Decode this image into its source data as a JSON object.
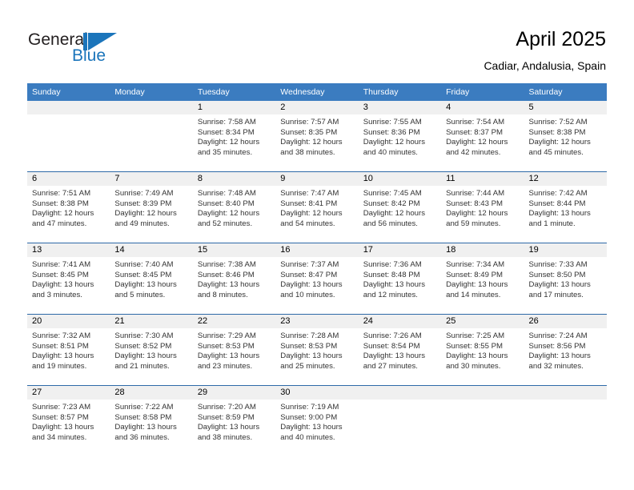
{
  "brand": {
    "name_part1": "General",
    "name_part2": "Blue",
    "logo_icon": "triangle-flag-icon",
    "accent_color": "#1b75bb"
  },
  "header": {
    "title": "April 2025",
    "subtitle": "Cadiar, Andalusia, Spain"
  },
  "theme": {
    "header_blue": "#3b7cc0",
    "row_divider_blue": "#2e6aa8",
    "daynum_band_gray": "#f0f0f0",
    "text_color": "#333333"
  },
  "calendar": {
    "weekday_headers": [
      "Sunday",
      "Monday",
      "Tuesday",
      "Wednesday",
      "Thursday",
      "Friday",
      "Saturday"
    ],
    "labels": {
      "sunrise": "Sunrise:",
      "sunset": "Sunset:",
      "daylight": "Daylight:"
    },
    "weeks": [
      [
        {
          "day": "",
          "empty": true
        },
        {
          "day": "",
          "empty": true
        },
        {
          "day": "1",
          "sunrise": "Sunrise: 7:58 AM",
          "sunset": "Sunset: 8:34 PM",
          "daylight_line1": "Daylight: 12 hours",
          "daylight_line2": "and 35 minutes."
        },
        {
          "day": "2",
          "sunrise": "Sunrise: 7:57 AM",
          "sunset": "Sunset: 8:35 PM",
          "daylight_line1": "Daylight: 12 hours",
          "daylight_line2": "and 38 minutes."
        },
        {
          "day": "3",
          "sunrise": "Sunrise: 7:55 AM",
          "sunset": "Sunset: 8:36 PM",
          "daylight_line1": "Daylight: 12 hours",
          "daylight_line2": "and 40 minutes."
        },
        {
          "day": "4",
          "sunrise": "Sunrise: 7:54 AM",
          "sunset": "Sunset: 8:37 PM",
          "daylight_line1": "Daylight: 12 hours",
          "daylight_line2": "and 42 minutes."
        },
        {
          "day": "5",
          "sunrise": "Sunrise: 7:52 AM",
          "sunset": "Sunset: 8:38 PM",
          "daylight_line1": "Daylight: 12 hours",
          "daylight_line2": "and 45 minutes."
        }
      ],
      [
        {
          "day": "6",
          "sunrise": "Sunrise: 7:51 AM",
          "sunset": "Sunset: 8:38 PM",
          "daylight_line1": "Daylight: 12 hours",
          "daylight_line2": "and 47 minutes."
        },
        {
          "day": "7",
          "sunrise": "Sunrise: 7:49 AM",
          "sunset": "Sunset: 8:39 PM",
          "daylight_line1": "Daylight: 12 hours",
          "daylight_line2": "and 49 minutes."
        },
        {
          "day": "8",
          "sunrise": "Sunrise: 7:48 AM",
          "sunset": "Sunset: 8:40 PM",
          "daylight_line1": "Daylight: 12 hours",
          "daylight_line2": "and 52 minutes."
        },
        {
          "day": "9",
          "sunrise": "Sunrise: 7:47 AM",
          "sunset": "Sunset: 8:41 PM",
          "daylight_line1": "Daylight: 12 hours",
          "daylight_line2": "and 54 minutes."
        },
        {
          "day": "10",
          "sunrise": "Sunrise: 7:45 AM",
          "sunset": "Sunset: 8:42 PM",
          "daylight_line1": "Daylight: 12 hours",
          "daylight_line2": "and 56 minutes."
        },
        {
          "day": "11",
          "sunrise": "Sunrise: 7:44 AM",
          "sunset": "Sunset: 8:43 PM",
          "daylight_line1": "Daylight: 12 hours",
          "daylight_line2": "and 59 minutes."
        },
        {
          "day": "12",
          "sunrise": "Sunrise: 7:42 AM",
          "sunset": "Sunset: 8:44 PM",
          "daylight_line1": "Daylight: 13 hours",
          "daylight_line2": "and 1 minute."
        }
      ],
      [
        {
          "day": "13",
          "sunrise": "Sunrise: 7:41 AM",
          "sunset": "Sunset: 8:45 PM",
          "daylight_line1": "Daylight: 13 hours",
          "daylight_line2": "and 3 minutes."
        },
        {
          "day": "14",
          "sunrise": "Sunrise: 7:40 AM",
          "sunset": "Sunset: 8:45 PM",
          "daylight_line1": "Daylight: 13 hours",
          "daylight_line2": "and 5 minutes."
        },
        {
          "day": "15",
          "sunrise": "Sunrise: 7:38 AM",
          "sunset": "Sunset: 8:46 PM",
          "daylight_line1": "Daylight: 13 hours",
          "daylight_line2": "and 8 minutes."
        },
        {
          "day": "16",
          "sunrise": "Sunrise: 7:37 AM",
          "sunset": "Sunset: 8:47 PM",
          "daylight_line1": "Daylight: 13 hours",
          "daylight_line2": "and 10 minutes."
        },
        {
          "day": "17",
          "sunrise": "Sunrise: 7:36 AM",
          "sunset": "Sunset: 8:48 PM",
          "daylight_line1": "Daylight: 13 hours",
          "daylight_line2": "and 12 minutes."
        },
        {
          "day": "18",
          "sunrise": "Sunrise: 7:34 AM",
          "sunset": "Sunset: 8:49 PM",
          "daylight_line1": "Daylight: 13 hours",
          "daylight_line2": "and 14 minutes."
        },
        {
          "day": "19",
          "sunrise": "Sunrise: 7:33 AM",
          "sunset": "Sunset: 8:50 PM",
          "daylight_line1": "Daylight: 13 hours",
          "daylight_line2": "and 17 minutes."
        }
      ],
      [
        {
          "day": "20",
          "sunrise": "Sunrise: 7:32 AM",
          "sunset": "Sunset: 8:51 PM",
          "daylight_line1": "Daylight: 13 hours",
          "daylight_line2": "and 19 minutes."
        },
        {
          "day": "21",
          "sunrise": "Sunrise: 7:30 AM",
          "sunset": "Sunset: 8:52 PM",
          "daylight_line1": "Daylight: 13 hours",
          "daylight_line2": "and 21 minutes."
        },
        {
          "day": "22",
          "sunrise": "Sunrise: 7:29 AM",
          "sunset": "Sunset: 8:53 PM",
          "daylight_line1": "Daylight: 13 hours",
          "daylight_line2": "and 23 minutes."
        },
        {
          "day": "23",
          "sunrise": "Sunrise: 7:28 AM",
          "sunset": "Sunset: 8:53 PM",
          "daylight_line1": "Daylight: 13 hours",
          "daylight_line2": "and 25 minutes."
        },
        {
          "day": "24",
          "sunrise": "Sunrise: 7:26 AM",
          "sunset": "Sunset: 8:54 PM",
          "daylight_line1": "Daylight: 13 hours",
          "daylight_line2": "and 27 minutes."
        },
        {
          "day": "25",
          "sunrise": "Sunrise: 7:25 AM",
          "sunset": "Sunset: 8:55 PM",
          "daylight_line1": "Daylight: 13 hours",
          "daylight_line2": "and 30 minutes."
        },
        {
          "day": "26",
          "sunrise": "Sunrise: 7:24 AM",
          "sunset": "Sunset: 8:56 PM",
          "daylight_line1": "Daylight: 13 hours",
          "daylight_line2": "and 32 minutes."
        }
      ],
      [
        {
          "day": "27",
          "sunrise": "Sunrise: 7:23 AM",
          "sunset": "Sunset: 8:57 PM",
          "daylight_line1": "Daylight: 13 hours",
          "daylight_line2": "and 34 minutes."
        },
        {
          "day": "28",
          "sunrise": "Sunrise: 7:22 AM",
          "sunset": "Sunset: 8:58 PM",
          "daylight_line1": "Daylight: 13 hours",
          "daylight_line2": "and 36 minutes."
        },
        {
          "day": "29",
          "sunrise": "Sunrise: 7:20 AM",
          "sunset": "Sunset: 8:59 PM",
          "daylight_line1": "Daylight: 13 hours",
          "daylight_line2": "and 38 minutes."
        },
        {
          "day": "30",
          "sunrise": "Sunrise: 7:19 AM",
          "sunset": "Sunset: 9:00 PM",
          "daylight_line1": "Daylight: 13 hours",
          "daylight_line2": "and 40 minutes."
        },
        {
          "day": "",
          "empty": true
        },
        {
          "day": "",
          "empty": true
        },
        {
          "day": "",
          "empty": true
        }
      ]
    ]
  }
}
